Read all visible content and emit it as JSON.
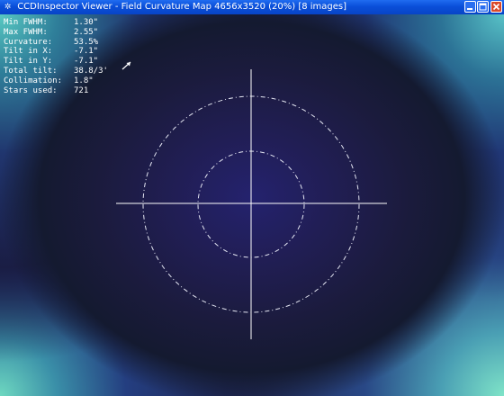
{
  "window": {
    "title": "CCDInspector Viewer - Field Curvature Map 4656x3520 (20%) [8 images]",
    "app_icon": "ccdinspector-icon",
    "buttons": {
      "minimize": "minimize-icon",
      "maximize": "maximize-icon",
      "close": "close-icon"
    }
  },
  "stats": [
    {
      "label": "Min FWHM:",
      "value": "1.30\""
    },
    {
      "label": "Max FWHM:",
      "value": "2.55\""
    },
    {
      "label": "Curvature:",
      "value": "53.5%"
    },
    {
      "label": "Tilt in X:",
      "value": "-7.1\""
    },
    {
      "label": "Tilt in Y:",
      "value": "-7.1\""
    },
    {
      "label": "Total tilt:",
      "value": "38.8/3'"
    },
    {
      "label": "Collimation:",
      "value": "1.8\""
    },
    {
      "label": "Stars used:",
      "value": "721"
    }
  ],
  "colors": {
    "center": "#24226e",
    "mid": "#1b1b3d",
    "corner_top": "#58c9c2",
    "corner_bottom": "#7fe4c8",
    "overlay_lines": "#ffffff",
    "title_bar": "#0a4fd9"
  },
  "icons": {
    "cursor": "mouse-pointer-icon"
  }
}
